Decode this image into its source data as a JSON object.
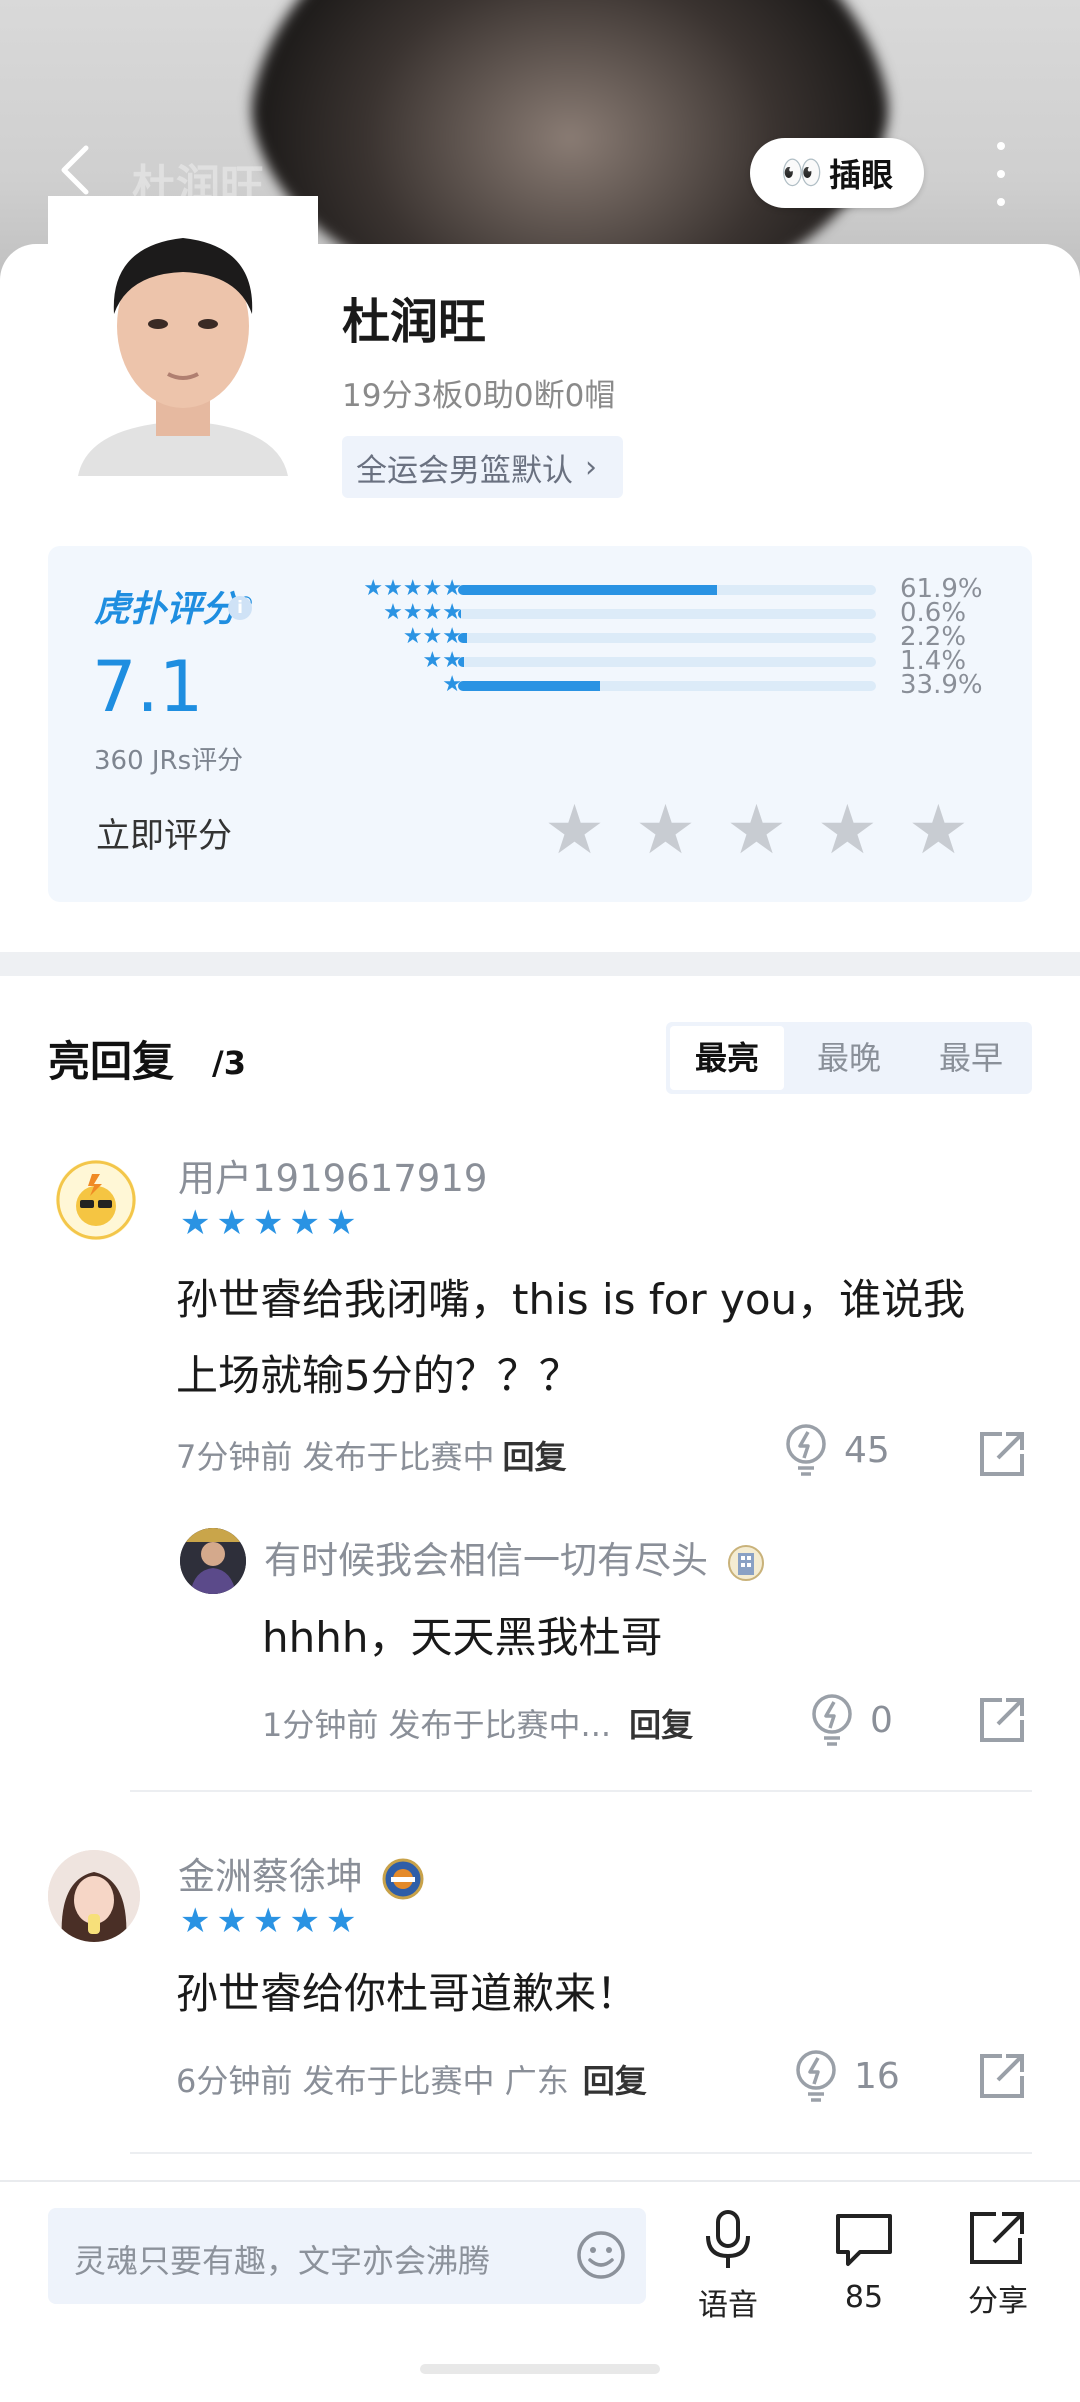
{
  "header": {
    "title": "杜润旺",
    "peek_emoji": "👀",
    "peek_label": "插眼"
  },
  "player": {
    "name": "杜润旺",
    "statline": "19分3板0助0断0帽",
    "tag": "全运会男篮默认",
    "tag_chevron": "›"
  },
  "rating": {
    "brand": "虎扑评分",
    "brand_mark": "®",
    "info": "i",
    "score": "7.1",
    "count": "360 JRs评分",
    "rate_now": "立即评分",
    "distribution": [
      {
        "stars": 5,
        "pct_label": "61.9%",
        "pct": 61.9
      },
      {
        "stars": 4,
        "pct_label": "0.6%",
        "pct": 0.6
      },
      {
        "stars": 3,
        "pct_label": "2.2%",
        "pct": 2.2
      },
      {
        "stars": 2,
        "pct_label": "1.4%",
        "pct": 1.4
      },
      {
        "stars": 1,
        "pct_label": "33.9%",
        "pct": 33.9
      }
    ],
    "star_color": "#2a93e3",
    "empty_star_color": "#c8ccd2"
  },
  "replies": {
    "title": "亮回复",
    "count": "/3",
    "sort_tabs": [
      "最亮",
      "最晚",
      "最早"
    ],
    "active_tab": "最亮",
    "items": [
      {
        "user": "用户1919617919",
        "stars": 5,
        "text_line1": "孙世睿给我闭嘴，this is for you，谁说我",
        "text_line2": "上场就输5分的？？？",
        "meta": "7分钟前 发布于比赛中",
        "reply_label": "回复",
        "likes": "45"
      },
      {
        "user": "有时候我会相信一切有尽头",
        "text": "hhhh，天天黑我杜哥",
        "meta": "1分钟前 发布于比赛中...",
        "reply_label": "回复",
        "likes": "0"
      },
      {
        "user": "金洲蔡徐坤",
        "stars": 5,
        "text": "孙世睿给你杜哥道歉来！",
        "meta": "6分钟前 发布于比赛中 广东",
        "reply_label": "回复",
        "likes": "16"
      }
    ]
  },
  "bottom_bar": {
    "input_placeholder": "灵魂只要有趣，文字亦会沸腾",
    "voice_label": "语音",
    "comments_count": "85",
    "share_label": "分享"
  },
  "colors": {
    "accent": "#1f8ee0",
    "muted": "#8a8f98"
  }
}
